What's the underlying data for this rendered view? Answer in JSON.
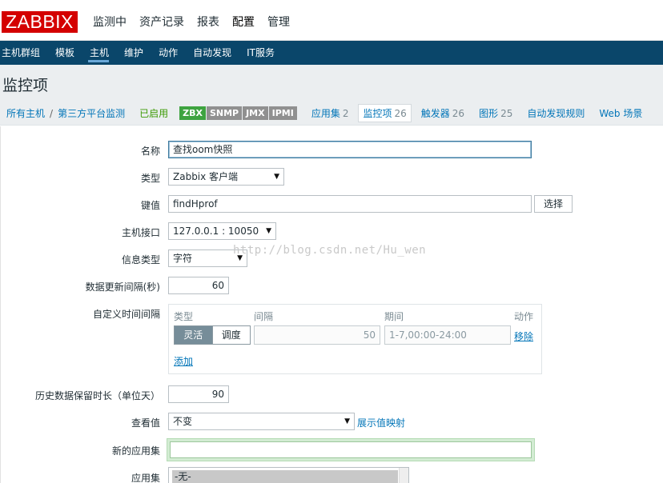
{
  "app": {
    "logo": "ZABBIX"
  },
  "topnav": [
    "监测中",
    "资产记录",
    "报表",
    "配置",
    "管理"
  ],
  "subnav": [
    "主机群组",
    "模板",
    "主机",
    "维护",
    "动作",
    "自动发现",
    "IT服务"
  ],
  "page": {
    "title": "监控项"
  },
  "breadcrumb": {
    "all_hosts": "所有主机",
    "separator": "/",
    "host": "第三方平台监测",
    "status": "已启用",
    "badges": [
      "ZBX",
      "SNMP",
      "JMX",
      "IPMI"
    ],
    "tabs": [
      {
        "label": "应用集",
        "count": "2"
      },
      {
        "label": "监控项",
        "count": "26"
      },
      {
        "label": "触发器",
        "count": "26"
      },
      {
        "label": "图形",
        "count": "25"
      },
      {
        "label": "自动发现规则",
        "count": ""
      },
      {
        "label": "Web 场景",
        "count": ""
      }
    ]
  },
  "form": {
    "name": {
      "label": "名称",
      "value": "查找oom快照"
    },
    "type": {
      "label": "类型",
      "value": "Zabbix 客户端"
    },
    "key": {
      "label": "键值",
      "value": "findHprof",
      "button": "选择"
    },
    "interface": {
      "label": "主机接口",
      "value": "127.0.0.1 : 10050"
    },
    "info_type": {
      "label": "信息类型",
      "value": "字符"
    },
    "update_interval": {
      "label": "数据更新间隔(秒)",
      "value": "60"
    },
    "custom_intervals": {
      "label": "自定义时间间隔",
      "headers": [
        "类型",
        "间隔",
        "期间",
        "动作"
      ],
      "mode_flexible": "灵活",
      "mode_scheduling": "调度",
      "interval": "50",
      "period": "1-7,00:00-24:00",
      "remove": "移除",
      "add": "添加"
    },
    "history": {
      "label": "历史数据保留时长（单位天）",
      "value": "90"
    },
    "show_value": {
      "label": "查看值",
      "value": "不变",
      "link": "展示值映射"
    },
    "new_application": {
      "label": "新的应用集",
      "value": ""
    },
    "applications": {
      "label": "应用集",
      "value": "-无-"
    }
  },
  "watermark": "http://blog.csdn.net/Hu_wen"
}
